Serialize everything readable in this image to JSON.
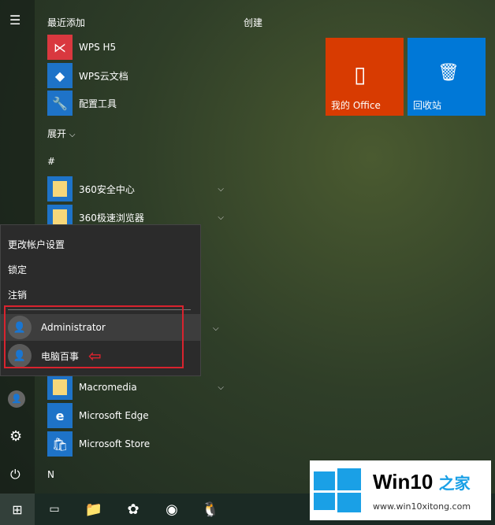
{
  "rail": {
    "icons": [
      "hamburger-icon",
      "user-icon",
      "gear-icon",
      "power-icon"
    ]
  },
  "recent": {
    "header": "最近添加",
    "items": [
      {
        "label": "WPS H5",
        "color": "#d9383f"
      },
      {
        "label": "WPS云文档",
        "color": "#1e73c8"
      },
      {
        "label": "配置工具",
        "color": "#1e73c8"
      }
    ]
  },
  "expand": "展开",
  "hash": "#",
  "apps_top": [
    {
      "label": "360安全中心"
    },
    {
      "label": "360极速浏览器"
    }
  ],
  "apps_bottom": [
    {
      "label": "Macromedia",
      "folder": true
    },
    {
      "label": "Microsoft Edge"
    },
    {
      "label": "Microsoft Store"
    }
  ],
  "letter_n": "N",
  "create": {
    "header": "创建",
    "tiles": [
      {
        "label": "我的 Office",
        "color": "#d83b01"
      },
      {
        "label": "回收站",
        "color": "#0078d7"
      }
    ]
  },
  "popup": {
    "items": [
      "更改帐户设置",
      "锁定",
      "注销"
    ],
    "users": [
      "Administrator",
      "电脑百事"
    ]
  },
  "annotation_color": "#d9232e",
  "watermark": {
    "title": "Win10",
    "title_cn": "之家",
    "url": "www.win10xitong.com"
  }
}
